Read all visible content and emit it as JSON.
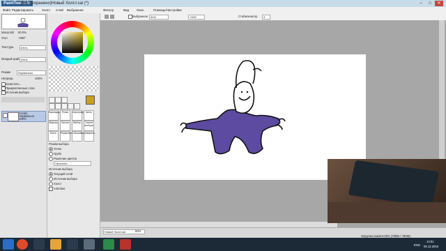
{
  "window": {
    "logo": "PaintTool SAI",
    "title": "(Не Сохранено)Новый Холст.sai (*)"
  },
  "menu": [
    "Файл",
    "Редактировать",
    "Холст",
    "Слой",
    "Выбранное",
    "Фильтр",
    "Вид",
    "Окно",
    "Помощь/Настройки"
  ],
  "left": {
    "zoom_label": "Масштаб",
    "zoom_value": "50.0%",
    "angle_label": "Угол",
    "angle_value": "+000°",
    "texture_label": "Текстура",
    "texture_value": "(Нет)",
    "effect_label": "Мокрый край",
    "effect_value": "(Нет)",
    "mode_label": "Режим",
    "mode_value": "Нормально",
    "opacity_label": "Непрозр.",
    "opacity_value": "100%",
    "checks": [
      "Зачистить...",
      "Прикрепленные слои",
      "Источник выбора"
    ],
    "layers": [
      {
        "name": "Слой1",
        "mode": "Нормально",
        "opacity": "100%"
      }
    ]
  },
  "brushes": [
    [
      "Карандаш",
      "Ручка",
      "Аэрограф",
      "Кисть"
    ],
    [
      "Маркер",
      "Ластик",
      "Выбор",
      "Снятие выбора"
    ],
    [
      "Кисть",
      "Размытие",
      "Смешивание",
      "Акварель"
    ]
  ],
  "selection": {
    "mode_title": "Режим выбора",
    "mode_options": [
      "Точно",
      "Грубо",
      "Различие цветов"
    ],
    "mode_dropdown": "Просеять",
    "source_title": "Источник выбора",
    "source_options": [
      "Текущий слой",
      "Источник выбора",
      "Холст"
    ],
    "antialias": "AntiAlias",
    "mode_selected_index": 0,
    "source_selected_index": 0
  },
  "toolbar": {
    "selection_label": "Выбранное",
    "zoom_value": "50%",
    "angle_value": "+000°",
    "stabilizer_label": "Стабилизатор",
    "stabilizer_value": "3"
  },
  "status": {
    "tab_name": "Новый Холст.sai",
    "tab_zoom": "50%",
    "memory": "Загрузка памяти:29% (78МБ / 78МБ)"
  },
  "taskbar": {
    "lang": "ENG",
    "time": "14:51",
    "date": "05.12.2015"
  },
  "colors": {
    "accent": "#2a5d8f",
    "figure_fill": "#5c4ba0",
    "taskbar": "#1c2a38"
  }
}
